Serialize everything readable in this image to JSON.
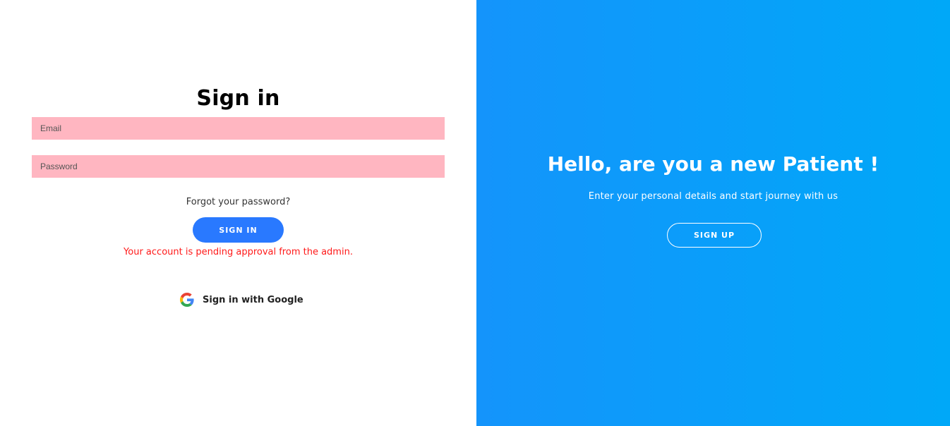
{
  "signin": {
    "title": "Sign in",
    "email_placeholder": "Email",
    "password_placeholder": "Password",
    "forgot_password": "Forgot your password?",
    "signin_button": "SIGN IN",
    "error_message": "Your account is pending approval from the admin.",
    "google_button": "Sign in with Google"
  },
  "signup_panel": {
    "title": "Hello, are you a new Patient !",
    "subtitle": "Enter your personal details and start journey with us",
    "signup_button": "SIGN UP"
  },
  "colors": {
    "input_background": "#ffb6c1",
    "primary_button": "#2979ff",
    "error_text": "#ff1a1a",
    "panel_gradient_start": "#1494fb",
    "panel_gradient_end": "#00a8f8"
  },
  "icons": {
    "google": "google-icon"
  }
}
